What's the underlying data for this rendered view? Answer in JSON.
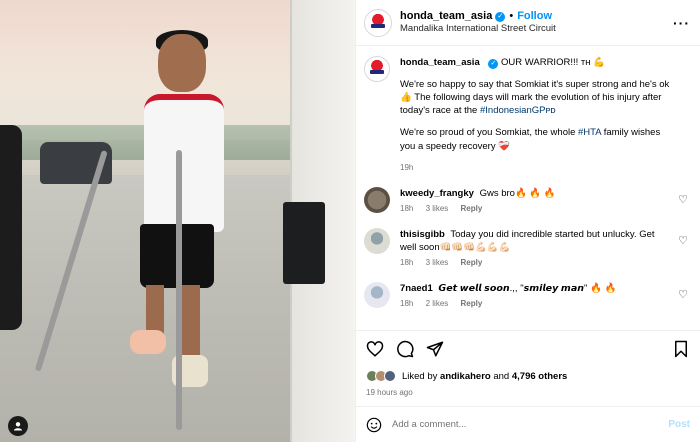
{
  "header": {
    "username": "honda_team_asia",
    "follow_label": "Follow",
    "location": "Mandalika International Street Circuit"
  },
  "caption": {
    "username": "honda_team_asia",
    "text_first": "OUR WARRIOR!!! ᴛʜ 💪",
    "para1": "We're so happy to say that Somkiat it's super strong and he's ok 👍 The following days will mark the evolution of his injury after today's race at the ",
    "hashtag1": "#IndonesianGPᴘᴅ",
    "para2_a": "We're so proud of you Somkiat, the whole ",
    "hashtag2": "#HTA",
    "para2_b": " family wishes you a speedy recovery ❤️‍🩹",
    "time": "19h"
  },
  "comments": [
    {
      "username": "kweedy_frangky",
      "text": "Gws bro🔥 🔥 🔥",
      "time": "18h",
      "likes": "3 likes",
      "reply": "Reply"
    },
    {
      "username": "thisisgibb",
      "text": "Today you did incredible started but unlucky. Get well soon👊🏻👊🏻👊🏻💪🏻💪🏻💪🏻",
      "time": "18h",
      "likes": "3 likes",
      "reply": "Reply"
    },
    {
      "username": "7naed1",
      "text": "𝙂𝙚𝙩 𝙬𝙚𝙡𝙡 𝙨𝙤𝙤𝙣.,, \"𝙨𝙢𝙞𝙡𝙚𝙮 𝙢𝙖𝙣\" 🔥 🔥",
      "time": "18h",
      "likes": "2 likes",
      "reply": "Reply"
    }
  ],
  "likes": {
    "prefix": "Liked by ",
    "user": "andikahero",
    "middle": " and ",
    "others": "4,796 others"
  },
  "posted_ago": "19 hours ago",
  "add_comment": {
    "placeholder": "Add a comment...",
    "post_label": "Post"
  },
  "colors": {
    "accent": "#0095f6",
    "post_disabled": "#b2dffc",
    "brand_red": "#e31b2b"
  },
  "icons": [
    "verified-badge-icon",
    "more-options-icon",
    "heart-icon",
    "comment-icon",
    "share-icon",
    "bookmark-icon",
    "emoji-icon",
    "user-tag-icon"
  ]
}
